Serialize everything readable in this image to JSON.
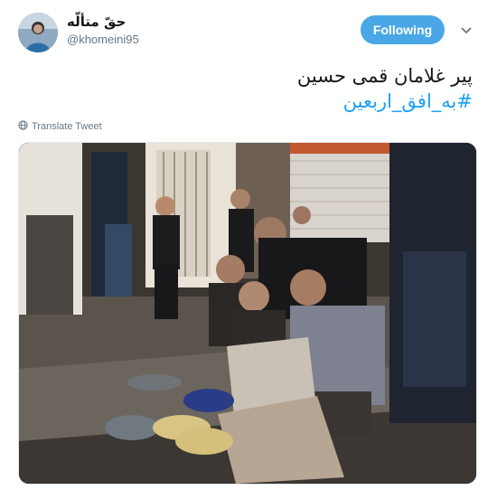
{
  "tweet": {
    "display_name": "حقّ متألّه",
    "handle": "@khomeini95",
    "follow_label": "Following",
    "text_line": "پیر غلامان قمی حسین",
    "hashtag": "#به_افق_اربعین",
    "translate_label": "Translate Tweet"
  },
  "icons": {
    "globe": "globe-icon",
    "caret": "chevron-down-icon"
  },
  "colors": {
    "accent": "#1da1f2",
    "follow_bg": "#4aa7e7",
    "secondary_text": "#657786"
  }
}
